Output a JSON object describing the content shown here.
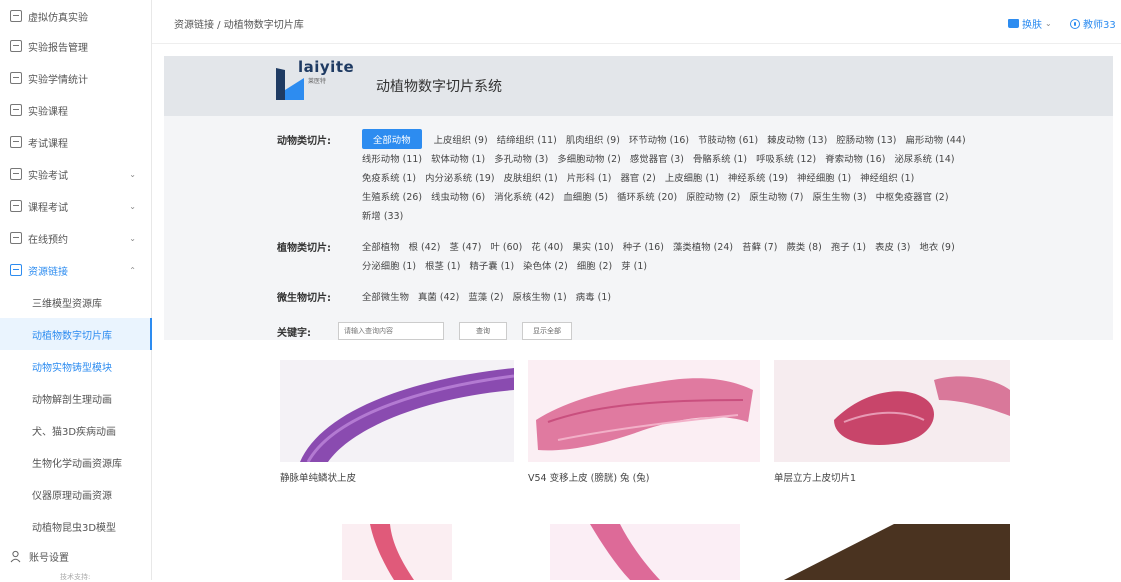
{
  "sidebar": {
    "items": [
      {
        "label": "虚拟仿真实验",
        "icon": "monitor-icon"
      },
      {
        "label": "实验报告管理",
        "icon": "report-icon"
      },
      {
        "label": "实验学情统计",
        "icon": "chart-icon"
      },
      {
        "label": "实验课程",
        "icon": "course-icon"
      },
      {
        "label": "考试课程",
        "icon": "exam-course-icon"
      },
      {
        "label": "实验考试",
        "icon": "edit-icon",
        "chevron": "⌄"
      },
      {
        "label": "课程考试",
        "icon": "edit-icon",
        "chevron": "⌄"
      },
      {
        "label": "在线预约",
        "icon": "calendar-icon",
        "chevron": "⌄"
      },
      {
        "label": "资源链接",
        "icon": "link-icon",
        "chevron": "⌃"
      }
    ],
    "sub_items": [
      "三维模型资源库",
      "动植物数字切片库",
      "动物实物铸型模块",
      "动物解剖生理动画",
      "犬、猫3D疾病动画",
      "生物化学动画资源库",
      "仪器原理动画资源",
      "动植物昆虫3D模型"
    ],
    "account": "账号设置",
    "footer": "技术支持:"
  },
  "header": {
    "breadcrumb": "资源链接 / 动植物数字切片库",
    "skin": "换肤",
    "teacher": "教师33"
  },
  "banner": {
    "logo_text": "laiyite",
    "logo_sub": "莱医特",
    "title": "动植物数字切片系统"
  },
  "filters": {
    "animal_label": "动物类切片:",
    "animal_lines": [
      [
        "全部动物",
        "上皮组织 (9)",
        "结缔组织 (11)",
        "肌肉组织 (9)",
        "环节动物 (16)",
        "节肢动物 (61)",
        "棘皮动物 (13)",
        "腔肠动物 (13)",
        "扁形动物 (44)"
      ],
      [
        "线形动物 (11)",
        "软体动物 (1)",
        "多孔动物 (3)",
        "多细胞动物 (2)",
        "感觉器官 (3)",
        "骨骼系统 (1)",
        "呼吸系统 (12)",
        "脊索动物 (16)",
        "泌尿系统 (14)"
      ],
      [
        "免疫系统 (1)",
        "内分泌系统 (19)",
        "皮肤组织 (1)",
        "片形科 (1)",
        "器官 (2)",
        "上皮细胞 (1)",
        "神经系统 (19)",
        "神经细胞 (1)",
        "神经组织 (1)"
      ],
      [
        "生殖系统 (26)",
        "线虫动物 (6)",
        "消化系统 (42)",
        "血细胞 (5)",
        "循环系统 (20)",
        "原腔动物 (2)",
        "原生动物 (7)",
        "原生生物 (3)",
        "中枢免疫器官 (2)"
      ],
      [
        "新增 (33)"
      ]
    ],
    "plant_label": "植物类切片:",
    "plant_lines": [
      [
        "全部植物",
        "根 (42)",
        "茎 (47)",
        "叶 (60)",
        "花 (40)",
        "果实 (10)",
        "种子 (16)",
        "藻类植物 (24)",
        "苔藓 (7)",
        "蕨类 (8)",
        "孢子 (1)",
        "表皮 (3)",
        "地衣 (9)"
      ],
      [
        "分泌细胞 (1)",
        "根茎 (1)",
        "精子囊 (1)",
        "染色体 (2)",
        "细胞 (2)",
        "芽 (1)"
      ]
    ],
    "micro_label": "微生物切片:",
    "micro_lines": [
      [
        "全部微生物",
        "真菌 (42)",
        "蓝藻 (2)",
        "原核生物 (1)",
        "病毒 (1)"
      ]
    ],
    "keyword_label": "关键字:",
    "keyword_placeholder": "请输入查询内容",
    "search_button": "查询",
    "show_all_button": "显示全部"
  },
  "gallery": {
    "items": [
      {
        "caption": "静脉单纯鳞状上皮",
        "stain": "#8a4bb0"
      },
      {
        "caption": "V54 变移上皮 (膀胱) 兔 (兔)",
        "stain": "#e07aa0"
      },
      {
        "caption": "单层立方上皮切片1",
        "stain": "#c8456a"
      },
      {
        "caption": "",
        "stain": "#e05a7a"
      },
      {
        "caption": "",
        "stain": "#dd6a98"
      },
      {
        "caption": "",
        "stain": "#4a3320"
      }
    ]
  },
  "colors": {
    "accent": "#2d8cf0",
    "banner_bg": "#e3e6ea",
    "filter_bg": "#f4f5f7"
  }
}
